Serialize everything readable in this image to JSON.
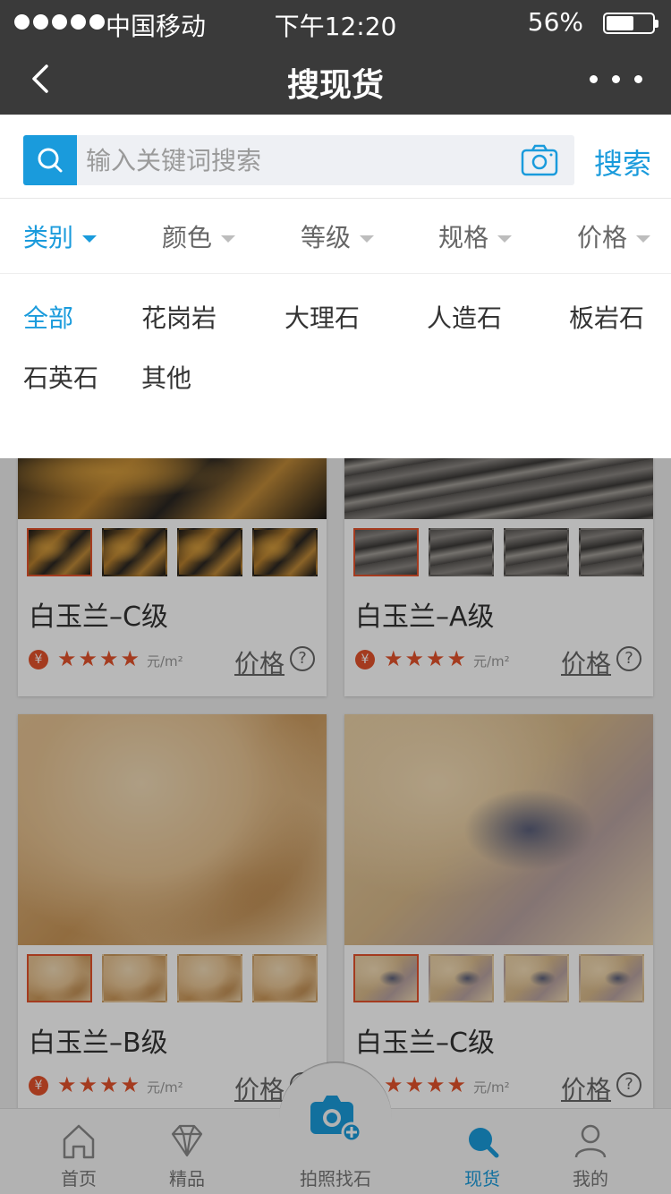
{
  "status_bar": {
    "carrier": "中国移动",
    "time": "下午12:20",
    "battery": "56%"
  },
  "nav": {
    "title": "搜现货",
    "back_icon": "chevron-left-icon",
    "more_icon": "more-dots-icon"
  },
  "search": {
    "placeholder": "输入关键词搜索",
    "value": "",
    "button_label": "搜索",
    "search_icon": "search-icon",
    "camera_icon": "camera-icon"
  },
  "filters": [
    {
      "label": "类别",
      "active": true
    },
    {
      "label": "颜色",
      "active": false
    },
    {
      "label": "等级",
      "active": false
    },
    {
      "label": "规格",
      "active": false
    },
    {
      "label": "价格",
      "active": false
    }
  ],
  "categories": [
    {
      "label": "全部",
      "active": true
    },
    {
      "label": "花岗岩",
      "active": false
    },
    {
      "label": "大理石",
      "active": false
    },
    {
      "label": "人造石",
      "active": false
    },
    {
      "label": "板岩石",
      "active": false
    },
    {
      "label": "石英石",
      "active": false
    },
    {
      "label": "其他",
      "active": false
    }
  ],
  "products": [
    {
      "name": "白玉兰–C级",
      "rating": 4,
      "stars": "★★★★",
      "unit": "元/m²",
      "price_label": "价格",
      "currency": "¥"
    },
    {
      "name": "白玉兰–A级",
      "rating": 4,
      "stars": "★★★★",
      "unit": "元/m²",
      "price_label": "价格",
      "currency": "¥"
    },
    {
      "name": "白玉兰–B级",
      "rating": 4,
      "stars": "★★★★",
      "unit": "元/m²",
      "price_label": "价格",
      "currency": "¥"
    },
    {
      "name": "白玉兰–C级",
      "rating": 4,
      "stars": "★★★★",
      "unit": "元/m²",
      "price_label": "价格",
      "currency": "¥"
    }
  ],
  "help_glyph": "?",
  "tabbar": {
    "items": [
      {
        "label": "首页",
        "icon": "home-icon",
        "active": false
      },
      {
        "label": "精品",
        "icon": "diamond-icon",
        "active": false
      },
      {
        "label": "拍照找石",
        "icon": "camera-add-icon",
        "active": false
      },
      {
        "label": "现货",
        "icon": "search-icon",
        "active": true
      },
      {
        "label": "我的",
        "icon": "user-icon",
        "active": false
      }
    ]
  },
  "colors": {
    "accent": "#1a9bdc",
    "price_red": "#e4522b",
    "nav_bg": "#3a3a3a"
  }
}
